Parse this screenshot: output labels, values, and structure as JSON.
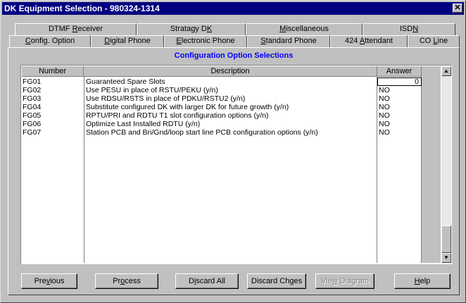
{
  "window": {
    "title": "DK Equipment Selection - 980324-1314",
    "close_glyph": "✕"
  },
  "tabs_back": [
    {
      "pre": "DTMF ",
      "key": "R",
      "post": "eceiver"
    },
    {
      "pre": "Stratagy D",
      "key": "K",
      "post": ""
    },
    {
      "pre": "",
      "key": "M",
      "post": "iscellaneous"
    },
    {
      "pre": "ISD",
      "key": "N",
      "post": ""
    }
  ],
  "tabs_front": [
    {
      "pre": "",
      "key": "C",
      "post": "onfig. Option"
    },
    {
      "pre": "",
      "key": "D",
      "post": "igital Phone"
    },
    {
      "pre": "",
      "key": "E",
      "post": "lectronic Phone"
    },
    {
      "pre": "",
      "key": "S",
      "post": "tandard Phone"
    },
    {
      "pre": "424 ",
      "key": "A",
      "post": "ttendant"
    },
    {
      "pre": "CO ",
      "key": "L",
      "post": "ine"
    }
  ],
  "section_title": "Configuration Option Selections",
  "table": {
    "headers": [
      "Number",
      "Description",
      "Answer"
    ],
    "rows": [
      {
        "number": "FG01",
        "description": "Guaranteed Spare Slots",
        "answer": "0"
      },
      {
        "number": "FG02",
        "description": "Use PESU in place of RSTU/PEKU (y/n)",
        "answer": "NO"
      },
      {
        "number": "FG03",
        "description": "Use RDSU/RSTS in place of PDKU/RSTU2 (y/n)",
        "answer": "NO"
      },
      {
        "number": "FG04",
        "description": "Substitute configured DK with larger DK for future growth (y/n)",
        "answer": "NO"
      },
      {
        "number": "FG05",
        "description": "RPTU/PRI and RDTU T1 slot configuration options (y/n)",
        "answer": "NO"
      },
      {
        "number": "FG06",
        "description": "Optimize Last Installed RDTU (y/n)",
        "answer": "NO"
      },
      {
        "number": "FG07",
        "description": "Station PCB and Bri/Gnd/loop start line PCB configuration options (y/n)",
        "answer": "NO"
      }
    ]
  },
  "scrollbar": {
    "up_glyph": "▲",
    "down_glyph": "▼"
  },
  "buttons": [
    {
      "pre": "Pre",
      "key": "v",
      "post": "ious",
      "disabled": false
    },
    {
      "pre": "Pr",
      "key": "o",
      "post": "cess",
      "disabled": false
    },
    {
      "pre": "D",
      "key": "i",
      "post": "scard All",
      "disabled": false
    },
    {
      "pre": "Discard Ch",
      "key": "g",
      "post": "es",
      "disabled": false
    },
    {
      "pre": "Vie",
      "key": "w",
      "post": " Diagram",
      "disabled": true
    },
    {
      "pre": "",
      "key": "H",
      "post": "elp",
      "disabled": false
    }
  ]
}
